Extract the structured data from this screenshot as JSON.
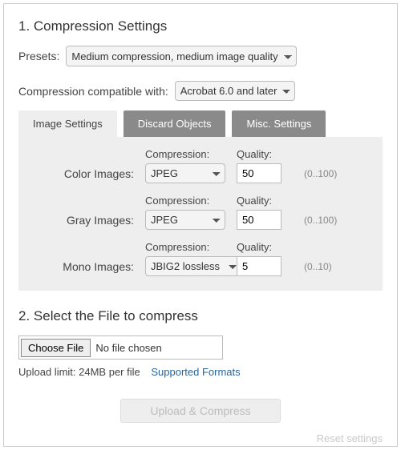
{
  "step1": {
    "heading": "1. Compression Settings",
    "presets_label": "Presets:",
    "presets_value": "Medium compression, medium image quality",
    "compat_label": "Compression compatible with:",
    "compat_value": "Acrobat 6.0 and later",
    "tabs": [
      {
        "label": "Image Settings"
      },
      {
        "label": "Discard Objects"
      },
      {
        "label": "Misc. Settings"
      }
    ],
    "panel": {
      "compression_hdr": "Compression:",
      "quality_hdr": "Quality:",
      "rows": [
        {
          "label": "Color Images:",
          "compression": "JPEG",
          "quality": "50",
          "range": "(0..100)"
        },
        {
          "label": "Gray Images:",
          "compression": "JPEG",
          "quality": "50",
          "range": "(0..100)"
        },
        {
          "label": "Mono Images:",
          "compression": "JBIG2 lossless",
          "quality": "5",
          "range": "(0..10)"
        }
      ]
    }
  },
  "step2": {
    "heading": "2. Select the File to compress",
    "choose_label": "Choose File",
    "no_file": "No file chosen",
    "limit_text": "Upload limit: 24MB per file",
    "formats_link": "Supported Formats",
    "upload_button": "Upload & Compress",
    "reset_link": "Reset settings"
  }
}
